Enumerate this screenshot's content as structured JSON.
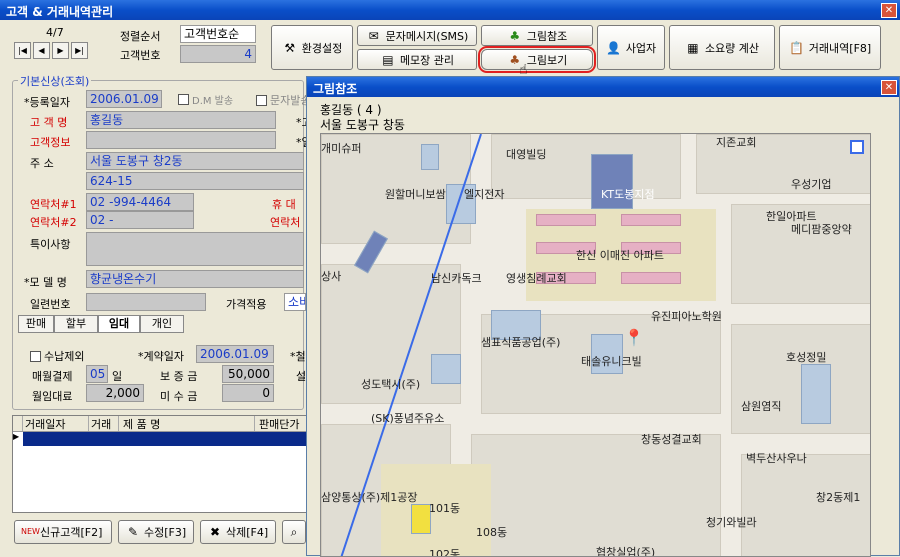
{
  "window": {
    "title": "고객 & 거래내역관리"
  },
  "record_nav": {
    "position": "4/7"
  },
  "sort": {
    "order_label": "정렬순서",
    "order_value": "고객번호순",
    "customer_no_label": "고객번호",
    "customer_no_value": "4"
  },
  "toolbar": {
    "env": "환경설정",
    "sms": "문자메시지(SMS)",
    "memo": "메모장 관리",
    "picture_ref": "그림참조",
    "picture_view": "그림보기",
    "business": "사업자",
    "consumption": "소요량 계산",
    "transactions": "거래내역[F8]"
  },
  "basic": {
    "section": "기본신상(조회)",
    "reg_date_label": "*등록일자",
    "reg_date": "2006.01.09",
    "dm_label": "D.M 발송",
    "sms_label": "문자발송",
    "name_label": "고 객 명",
    "name": "홍길동",
    "info_label": "고객정보",
    "addr_label": "주 소",
    "addr1": "서울 도봉구 창2동",
    "addr2": "624-15",
    "contact1_label": "연락처#1",
    "contact1": "02 -994-4464",
    "contact2_label": "연락처#2",
    "contact2": "02 -",
    "mobile_label": "휴 대",
    "contact_label": "연락처",
    "note_label": "특이사항",
    "model_label": "*모 델 명",
    "model": "향균냉온수기",
    "serial_label": "일련번호",
    "price_label": "가격적용",
    "price": "소비",
    "right_col_a": "*고",
    "right_col_b": "*일"
  },
  "tabs": [
    "판매",
    "할부",
    "임대",
    "개인"
  ],
  "rental": {
    "unpaid_label": "수납제외",
    "contract_label": "*계약일자",
    "contract": "2006.01.09",
    "install_label": "*철",
    "monthly_label": "매월결제",
    "monthly_day": "05",
    "day_unit": "일",
    "deposit_label": "보 증 금",
    "deposit": "50,000",
    "setting_label": "설",
    "fee_label": "월임대료",
    "fee": "2,000",
    "unpaid_amt_label": "미 수 금",
    "unpaid_amt": "0"
  },
  "grid": {
    "headers": [
      "거래일자",
      "거래",
      "제 품 명",
      "판매단가"
    ]
  },
  "bottom": {
    "new": "신규고객[F2]",
    "edit": "수정[F3]",
    "delete": "삭제[F4]"
  },
  "popup": {
    "title": "그림참조",
    "line1": "홍길동 ( 4 )",
    "line2": "서울 도봉구 창동"
  },
  "map_labels": [
    "개미슈퍼",
    "대영빌딩",
    "지존교회",
    "원할머니보쌈",
    "엘지전자",
    "KT도봉지점",
    "우성기업",
    "한일아파트",
    "메디팜중앙약",
    "한신 이매진 아파트",
    "상사",
    "남신카독크",
    "영생침례교회",
    "유진피아노학원",
    "샘표식품공업(주)",
    "태솔유니크빌",
    "호성정밀",
    "성도택시(주)",
    "삼원염직",
    "(SK)풍념주유소",
    "창동성결교회",
    "벽두산사우나",
    "삼양통상(주)제1공장",
    "창2동제1",
    "101동",
    "108동",
    "청기와빌라",
    "협창실업(주)",
    "102동"
  ]
}
